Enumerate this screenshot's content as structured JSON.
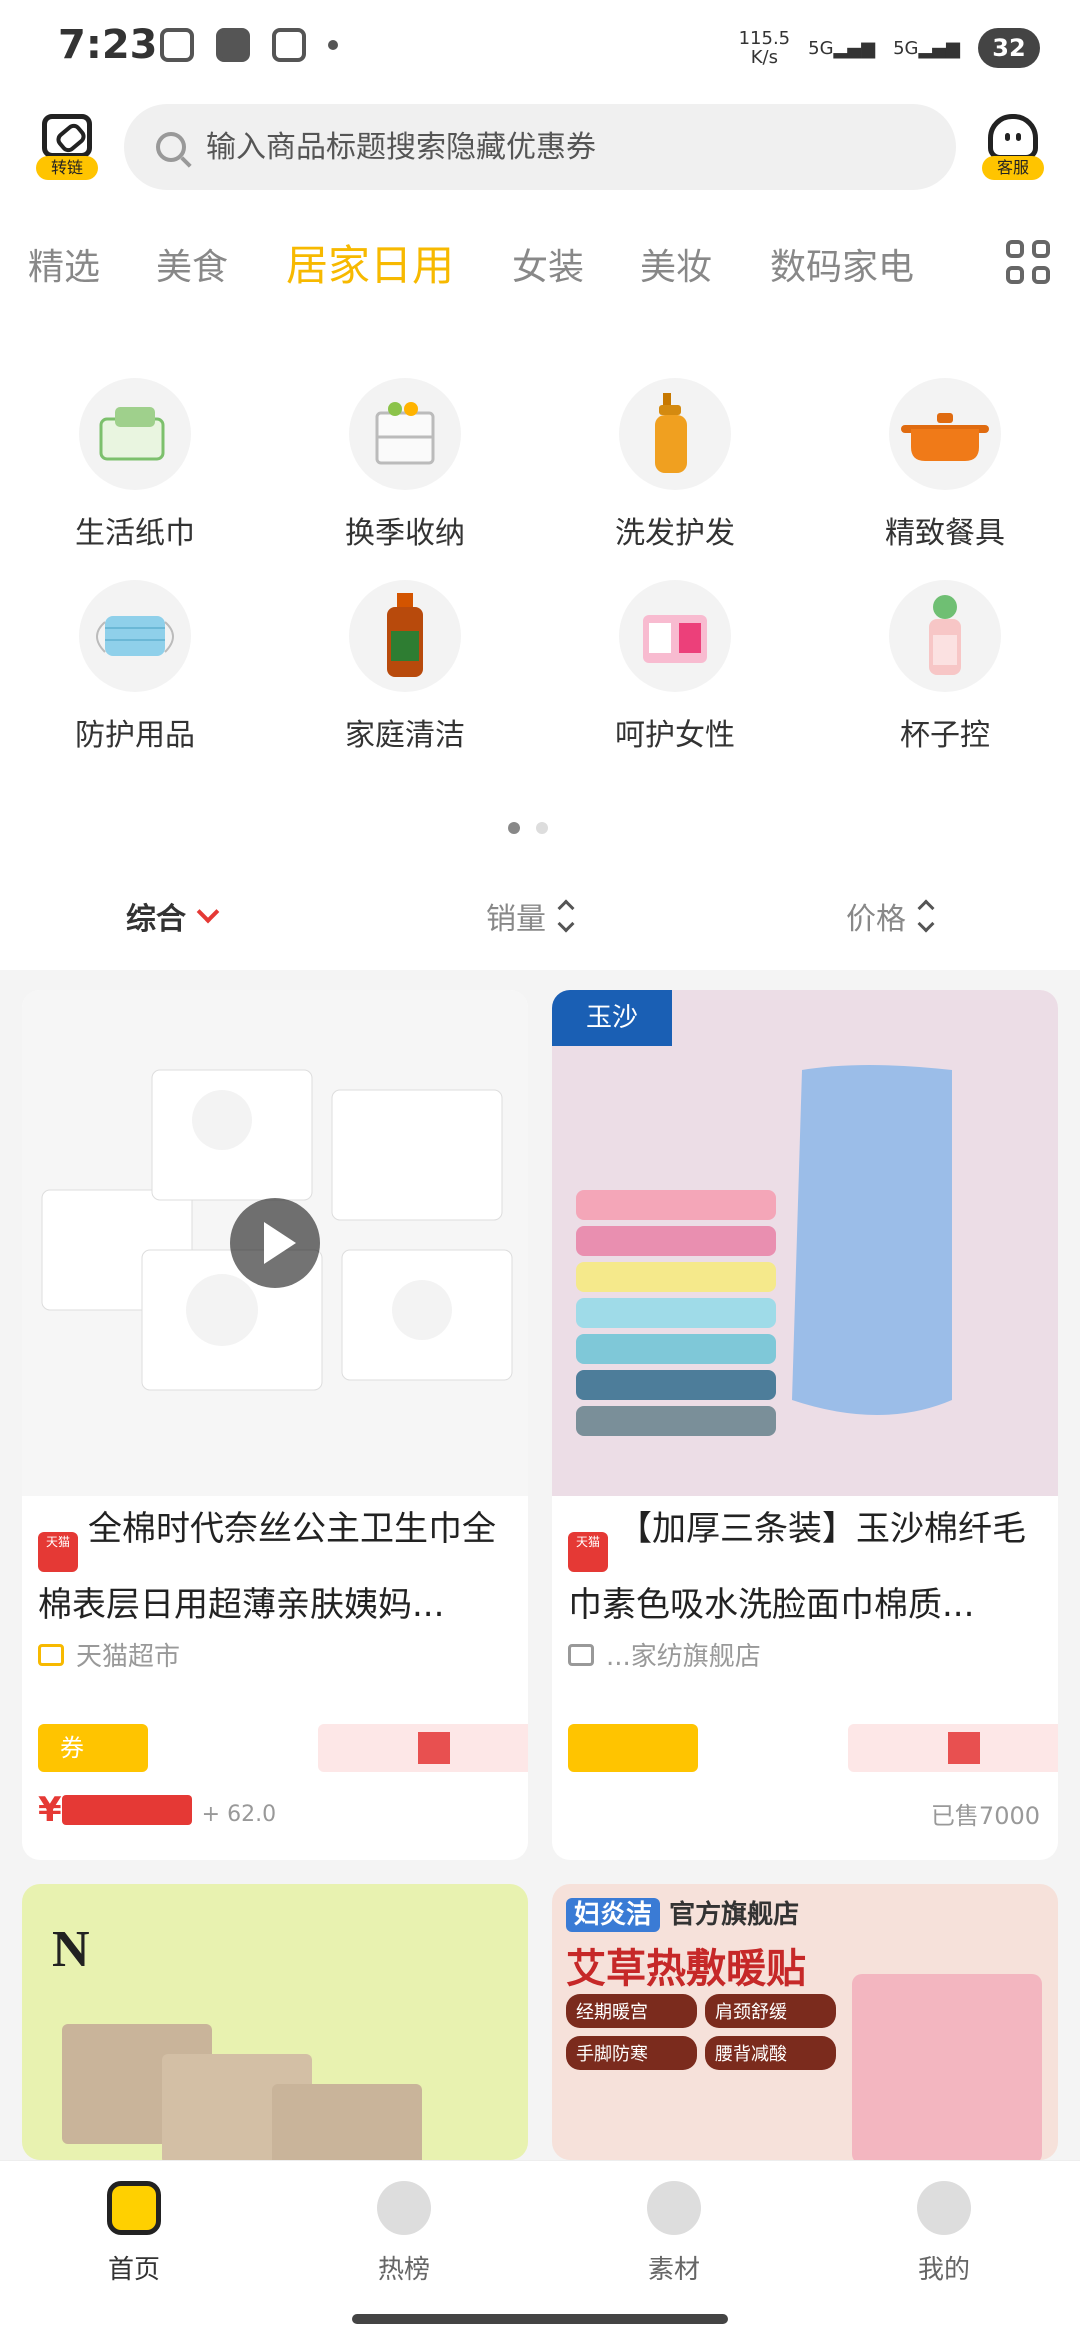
{
  "status": {
    "time": "7:23",
    "speed_value": "115.5",
    "speed_unit": "K/s",
    "net1": "5G",
    "net2": "5G",
    "battery": "32"
  },
  "header": {
    "link_label": "转链",
    "service_label": "客服",
    "search_placeholder": "输入商品标题搜索隐藏优惠券"
  },
  "tabs": [
    "精选",
    "美食",
    "居家日用",
    "女装",
    "美妆",
    "数码家电"
  ],
  "active_tab": "居家日用",
  "categories": [
    {
      "label": "生活纸巾",
      "icon": "tissue-icon"
    },
    {
      "label": "换季收纳",
      "icon": "storage-box-icon"
    },
    {
      "label": "洗发护发",
      "icon": "shampoo-icon"
    },
    {
      "label": "精致餐具",
      "icon": "pot-icon"
    },
    {
      "label": "防护用品",
      "icon": "mask-icon"
    },
    {
      "label": "家庭清洁",
      "icon": "disinfectant-icon"
    },
    {
      "label": "呵护女性",
      "icon": "pad-icon"
    },
    {
      "label": "杯子控",
      "icon": "cup-icon"
    }
  ],
  "sort": {
    "combined": "综合",
    "sales": "销量",
    "price": "价格"
  },
  "products": [
    {
      "mall": "天猫",
      "title": "全棉时代奈丝公主卫生巾全棉表层日用超薄亲肤姨妈...",
      "shop": "天猫超市",
      "coupon": "券",
      "price": "¥",
      "rebate_text": "+ 62.0"
    },
    {
      "mall": "天猫",
      "title": "【加厚三条装】玉沙棉纤毛巾素色吸水洗脸面巾棉质...",
      "shop": "...家纺旗舰店",
      "brand_logo": "玉沙",
      "sold": "已售7000"
    }
  ],
  "promo2": {
    "brand": "妇炎洁",
    "store": "官方旗舰店",
    "headline": "艾草热敷暖贴",
    "tags": [
      "经期暖宫",
      "肩颈舒缓",
      "手脚防寒",
      "腰背减酸"
    ]
  },
  "nav": [
    "首页",
    "热榜",
    "素材",
    "我的"
  ],
  "colors": {
    "accent": "#f7b900",
    "price": "#e53935"
  }
}
